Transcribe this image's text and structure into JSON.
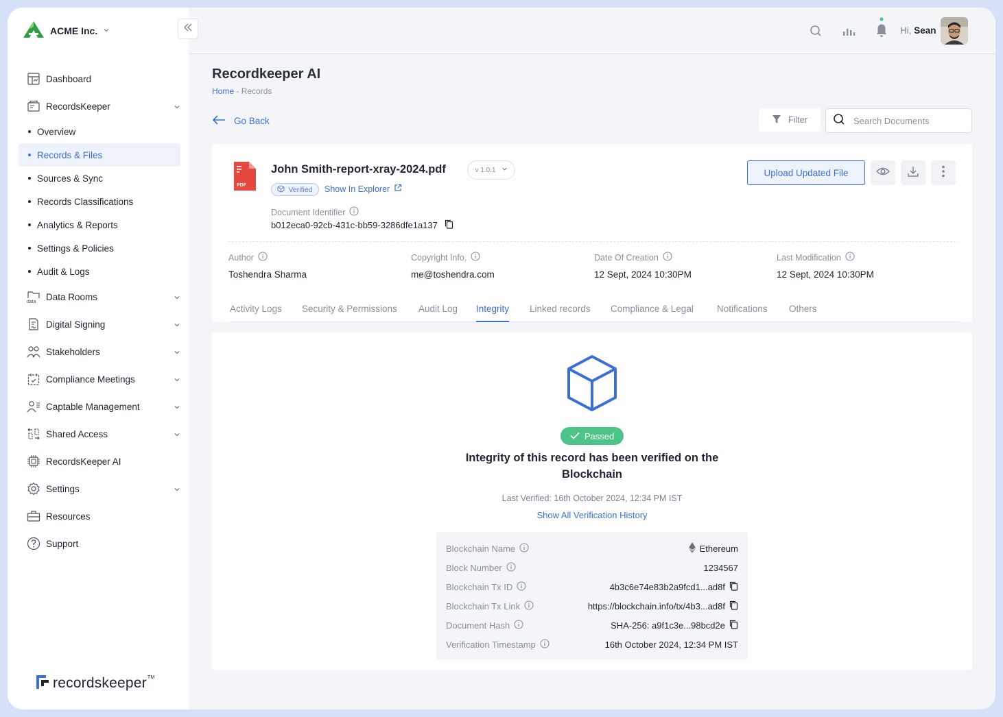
{
  "sidebar": {
    "org_name": "ACME Inc.",
    "nav": [
      {
        "label": "Dashboard",
        "icon": "dashboard-icon",
        "chevron": false
      },
      {
        "label": "RecordsKeeper",
        "icon": "records-icon",
        "chevron": true
      }
    ],
    "sub_items": [
      {
        "label": "Overview",
        "active": false
      },
      {
        "label": "Records & Files",
        "active": true
      },
      {
        "label": "Sources & Sync",
        "active": false
      },
      {
        "label": "Records Classifications",
        "active": false
      },
      {
        "label": "Analytics & Reports",
        "active": false
      },
      {
        "label": "Settings & Policies",
        "active": false
      },
      {
        "label": "Audit & Logs",
        "active": false
      }
    ],
    "nav_lower": [
      {
        "label": "Data Rooms",
        "icon": "data-rooms-icon",
        "chevron": true
      },
      {
        "label": "Digital Signing",
        "icon": "digital-signing-icon",
        "chevron": true
      },
      {
        "label": "Stakeholders",
        "icon": "stakeholders-icon",
        "chevron": true
      },
      {
        "label": "Compliance Meetings",
        "icon": "calendar-icon",
        "chevron": true
      },
      {
        "label": "Captable Management",
        "icon": "captable-icon",
        "chevron": true
      },
      {
        "label": "Shared Access",
        "icon": "shared-access-icon",
        "chevron": true
      },
      {
        "label": "RecordsKeeper AI",
        "icon": "ai-chip-icon",
        "chevron": false
      },
      {
        "label": "Settings",
        "icon": "gear-icon",
        "chevron": true
      },
      {
        "label": "Resources",
        "icon": "briefcase-icon",
        "chevron": false
      },
      {
        "label": "Support",
        "icon": "help-icon",
        "chevron": false
      }
    ],
    "brand": "recordskeeper",
    "brand_tm": "TM"
  },
  "topbar": {
    "greeting_prefix": "Hi,",
    "user_name": "Sean"
  },
  "header": {
    "title": "Recordkeeper AI",
    "breadcrumb_home": "Home",
    "breadcrumb_sep": " - ",
    "breadcrumb_current": "Records",
    "go_back": "Go Back",
    "filter_label": "Filter",
    "search_placeholder": "Search Documents"
  },
  "document": {
    "file_name": "John Smith-report-xray-2024.pdf",
    "version": "v 1.0.1",
    "verified_label": "Verified",
    "explorer_link": "Show In Explorer",
    "identifier_label": "Document Identifier",
    "identifier": "b012eca0-92cb-431c-bb59-3286dfe1a137",
    "upload_label": "Upload Updated File",
    "pdf_badge": "PDF",
    "meta": [
      {
        "label": "Author",
        "value": "Toshendra Sharma"
      },
      {
        "label": "Copyright Info.",
        "value": "me@toshendra.com"
      },
      {
        "label": "Date Of Creation",
        "value": "12 Sept, 2024 10:30PM"
      },
      {
        "label": "Last Modification",
        "value": "12 Sept, 2024 10:30PM"
      }
    ],
    "tabs": [
      {
        "label": "Activity Logs",
        "active": false
      },
      {
        "label": "Security & Permissions",
        "active": false
      },
      {
        "label": "Audit Log",
        "active": false
      },
      {
        "label": "Integrity",
        "active": true
      },
      {
        "label": "Linked records",
        "active": false
      },
      {
        "label": "Compliance & Legal",
        "active": false
      },
      {
        "label": "Notifications",
        "active": false
      },
      {
        "label": "Others",
        "active": false
      }
    ]
  },
  "integrity": {
    "status": "Passed",
    "title_line1": "Integrity of this record has been verified on the",
    "title_line2": "Blockchain",
    "last_verified": "Last Verified: 16th October 2024, 12:34 PM IST",
    "history_link": "Show All Verification History",
    "rows": [
      {
        "label": "Blockchain Name",
        "value": "Ethereum",
        "copy": false,
        "eth": true
      },
      {
        "label": "Block Number",
        "value": "1234567",
        "copy": false,
        "eth": false
      },
      {
        "label": "Blockchain Tx ID",
        "value": "4b3c6e74e83b2a9fcd1...ad8f",
        "copy": true,
        "eth": false
      },
      {
        "label": "Blockchain Tx Link",
        "value": "https://blockchain.info/tx/4b3...ad8f",
        "copy": true,
        "eth": false
      },
      {
        "label": "Document Hash",
        "value": "SHA-256: a9f1c3e...98bcd2e",
        "copy": true,
        "eth": false
      },
      {
        "label": "Verification Timestamp",
        "value": "16th October 2024, 12:34 PM IST",
        "copy": false,
        "eth": false
      }
    ]
  },
  "colors": {
    "accent": "#3b6fd4",
    "success": "#4cc488",
    "pdf_red": "#e5483f",
    "logo_green": "#2f9e44"
  }
}
